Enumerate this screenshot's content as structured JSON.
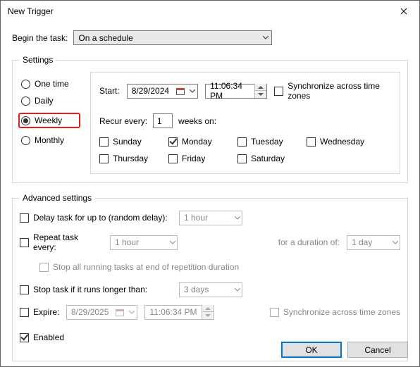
{
  "title": "New Trigger",
  "begin": {
    "label": "Begin the task:",
    "value": "On a schedule"
  },
  "settings": {
    "legend": "Settings",
    "radios": {
      "one_time": "One time",
      "daily": "Daily",
      "weekly": "Weekly",
      "monthly": "Monthly",
      "selected": "weekly"
    },
    "start": {
      "label": "Start:",
      "date": "8/29/2024",
      "time": "11:06:34 PM",
      "sync_label": "Synchronize across time zones",
      "sync_checked": false
    },
    "recur": {
      "label_prefix": "Recur every:",
      "value": "1",
      "label_suffix": "weeks on:"
    },
    "days": {
      "sunday": {
        "label": "Sunday",
        "checked": false
      },
      "monday": {
        "label": "Monday",
        "checked": true
      },
      "tuesday": {
        "label": "Tuesday",
        "checked": false
      },
      "wednesday": {
        "label": "Wednesday",
        "checked": false
      },
      "thursday": {
        "label": "Thursday",
        "checked": false
      },
      "friday": {
        "label": "Friday",
        "checked": false
      },
      "saturday": {
        "label": "Saturday",
        "checked": false
      }
    }
  },
  "advanced": {
    "legend": "Advanced settings",
    "delay": {
      "label": "Delay task for up to (random delay):",
      "value": "1 hour",
      "checked": false
    },
    "repeat": {
      "label": "Repeat task every:",
      "value": "1 hour",
      "checked": false,
      "duration_label": "for a duration of:",
      "duration_value": "1 day",
      "stop_label": "Stop all running tasks at end of repetition duration",
      "stop_checked": false
    },
    "stop": {
      "label": "Stop task if it runs longer than:",
      "value": "3 days",
      "checked": false
    },
    "expire": {
      "label": "Expire:",
      "checked": false,
      "date": "8/29/2025",
      "time": "11:06:34 PM",
      "sync_label": "Synchronize across time zones",
      "sync_checked": false
    },
    "enabled": {
      "label": "Enabled",
      "checked": true
    }
  },
  "buttons": {
    "ok": "OK",
    "cancel": "Cancel"
  }
}
